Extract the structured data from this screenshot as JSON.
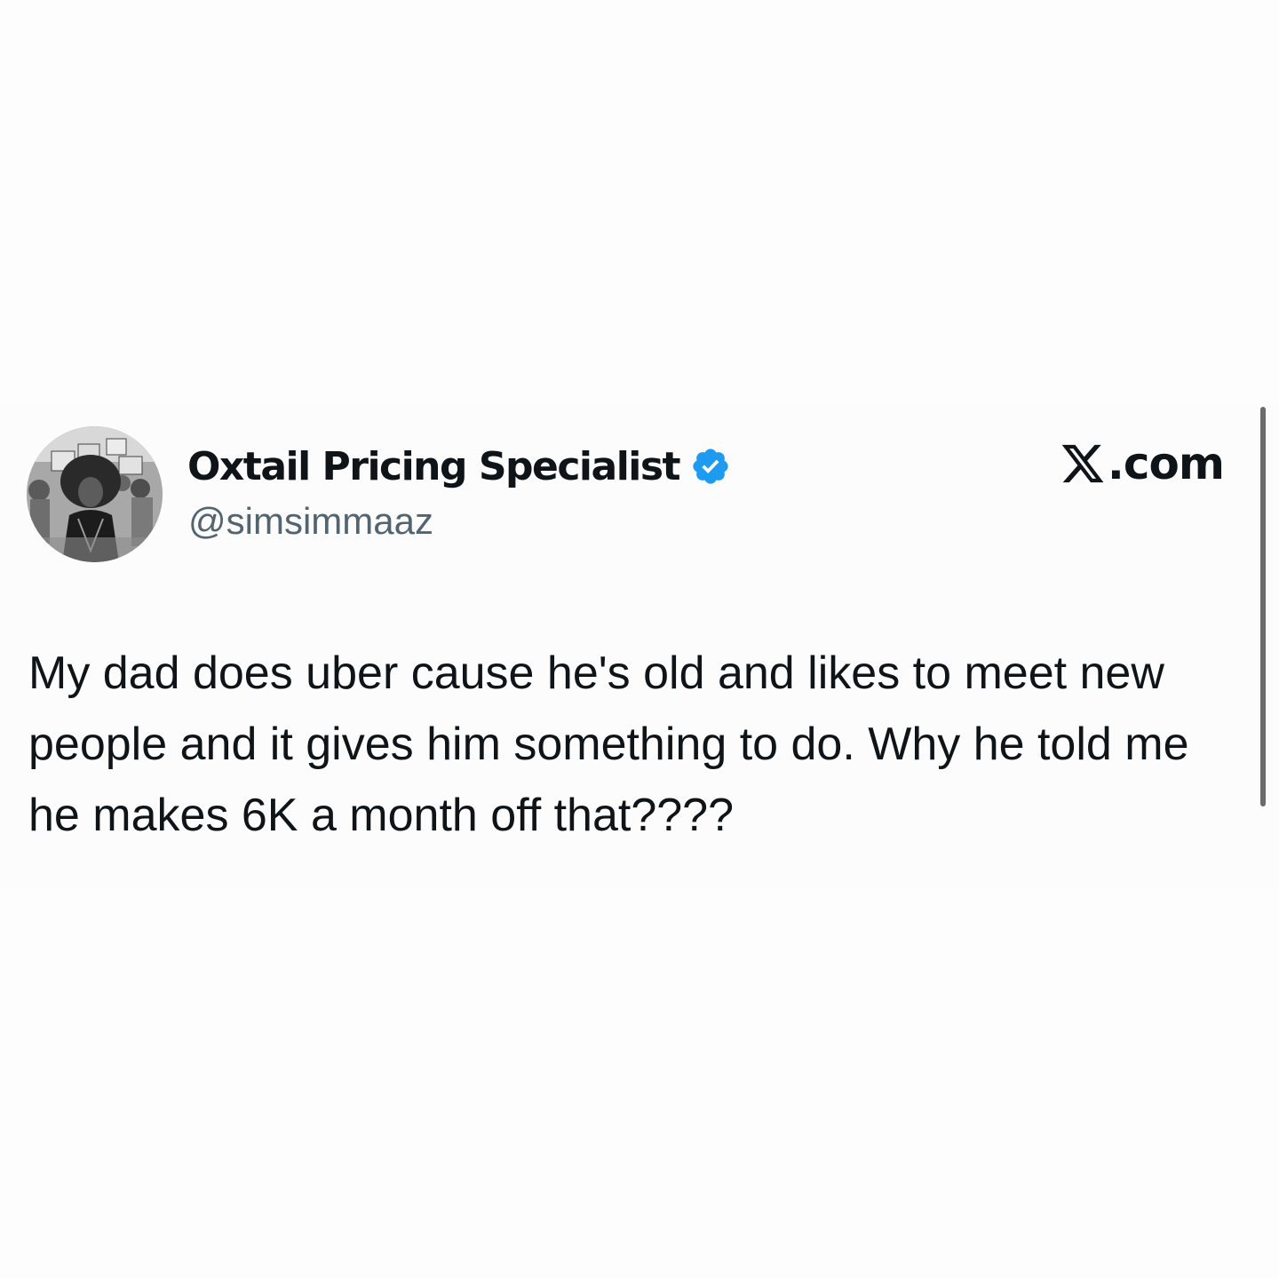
{
  "post": {
    "author": {
      "display_name": "Oxtail Pricing Specialist",
      "handle": "@simsimmaaz",
      "verified": true,
      "verified_icon": "verified-badge-icon",
      "avatar": "profile-photo"
    },
    "site": {
      "logo_icon": "x-logo-icon",
      "label": ".com"
    },
    "text": "My dad does uber cause he's old and likes to meet new people and it gives him something to do. Why he told me he makes 6K a month off that????"
  },
  "colors": {
    "background": "#fdfdfd",
    "text_primary": "#0f1419",
    "text_secondary": "#536471",
    "verified_blue": "#1d9bf0",
    "scrollbar": "#6b6b6b"
  }
}
